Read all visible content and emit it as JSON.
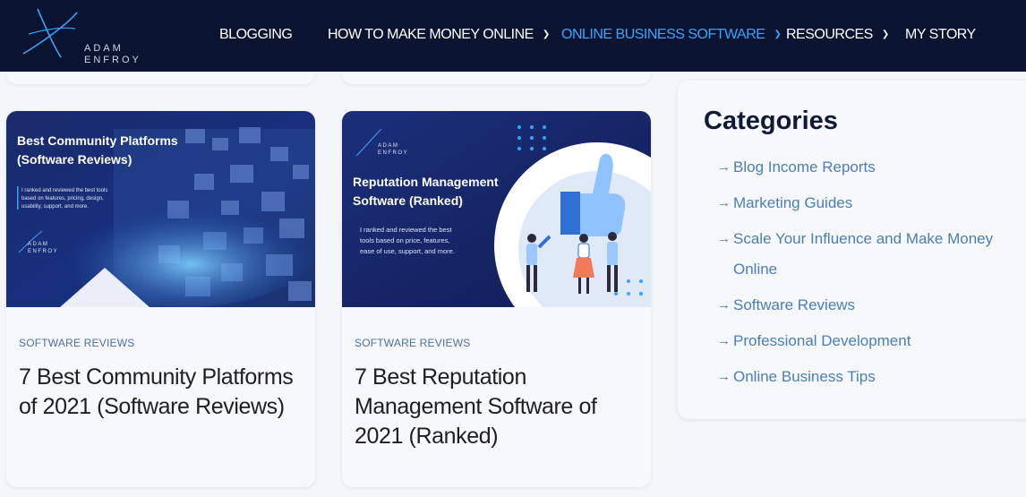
{
  "logo": {
    "line1": "ADAM",
    "line2": "ENFROY"
  },
  "nav": {
    "blogging": "BLOGGING",
    "make_money": "HOW TO MAKE MONEY ONLINE",
    "software": "ONLINE BUSINESS SOFTWARE",
    "resources": "RESOURCES",
    "my_story": "MY STORY"
  },
  "cards": [
    {
      "image_title_1": "Best Community Platforms",
      "image_title_2": "(Software Reviews)",
      "image_desc_1": "I ranked and reviewed the best tools",
      "image_desc_2": "based on features, pricing, design,",
      "image_desc_3": "usability, support, and more.",
      "category": "SOFTWARE REVIEWS",
      "title": "7 Best Community Platforms of 2021 (Software Reviews)"
    },
    {
      "image_title_1": "Reputation Management",
      "image_title_2": "Software (Ranked)",
      "image_desc_1": "I ranked and reviewed the best",
      "image_desc_2": "tools based on price, features,",
      "image_desc_3": "ease of use, support, and more.",
      "category": "SOFTWARE REVIEWS",
      "title": "7 Best Reputation Management Software of 2021 (Ranked)"
    }
  ],
  "sidebar": {
    "title": "Categories",
    "items": [
      "Blog Income Reports",
      "Marketing Guides",
      "Scale Your Influence and Make Money Online",
      "Software Reviews",
      "Professional Development",
      "Online Business Tips"
    ]
  },
  "colors": {
    "nav_bg": "#0a1430",
    "accent": "#3aa3ff",
    "link": "#4a7fb5"
  }
}
